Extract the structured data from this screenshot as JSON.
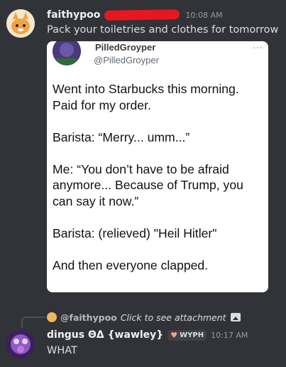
{
  "message1": {
    "username": "faithypoo",
    "timestamp": "10:08 AM",
    "content": "Pack your toiletries and clothes for tomorrow",
    "embed": {
      "display_name": "PilledGroyper",
      "handle": "@PilledGroyper",
      "more": "···",
      "body": "Went into Starbucks this morning. Paid for my order.\n\nBarista: “Merry... umm...”\n\nMe: “You don’t have to be afraid anymore... Because of Trump, you can say it now.”\n\nBarista: (relieved) \"Heil Hitler\"\n\nAnd then everyone clapped."
    }
  },
  "reply_preview": {
    "username": "@faithypoo",
    "text": "Click to see attachment",
    "icon": "image-icon"
  },
  "message2": {
    "username": "dingus ΘΔ {wawley}",
    "tag": "WYPH",
    "tag_icon": "heart-icon",
    "timestamp": "10:17 AM",
    "content": "WHAT"
  },
  "colors": {
    "background": "#313338",
    "redaction": "#e8171f",
    "embed_bg": "#ffffff"
  }
}
